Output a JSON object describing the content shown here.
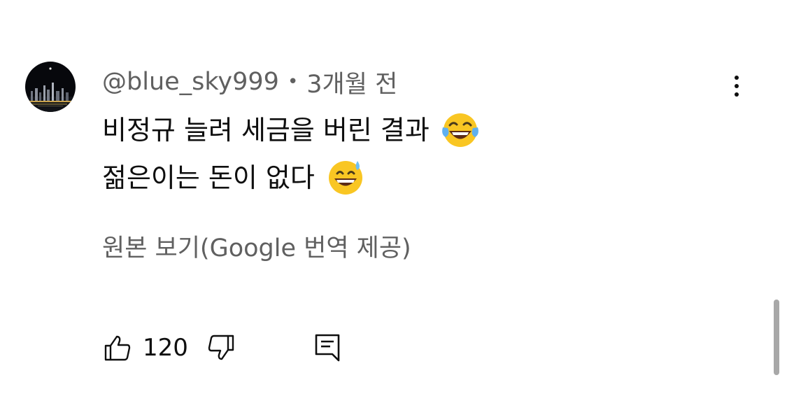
{
  "comment": {
    "author": "@blue_sky999",
    "separator": "•",
    "timestamp": "3개월 전",
    "text_lines": [
      "비정규 늘려 세금을 버린 결과",
      "젊은이는 돈이 없다"
    ],
    "emojis": [
      "face-with-tears-of-joy-icon",
      "grinning-face-with-sweat-icon"
    ],
    "translation_link": "원본 보기(Google 번역 제공)",
    "like_count": "120"
  },
  "icons": {
    "menu": "more-vert-icon",
    "like": "thumbs-up-icon",
    "dislike": "thumbs-down-icon",
    "reply": "reply-comment-icon"
  },
  "colors": {
    "primary_text": "#0f0f0f",
    "secondary_text": "#606060",
    "background": "#ffffff",
    "scrollbar": "#a8a8a8",
    "emoji_yellow": "#f9c623"
  }
}
